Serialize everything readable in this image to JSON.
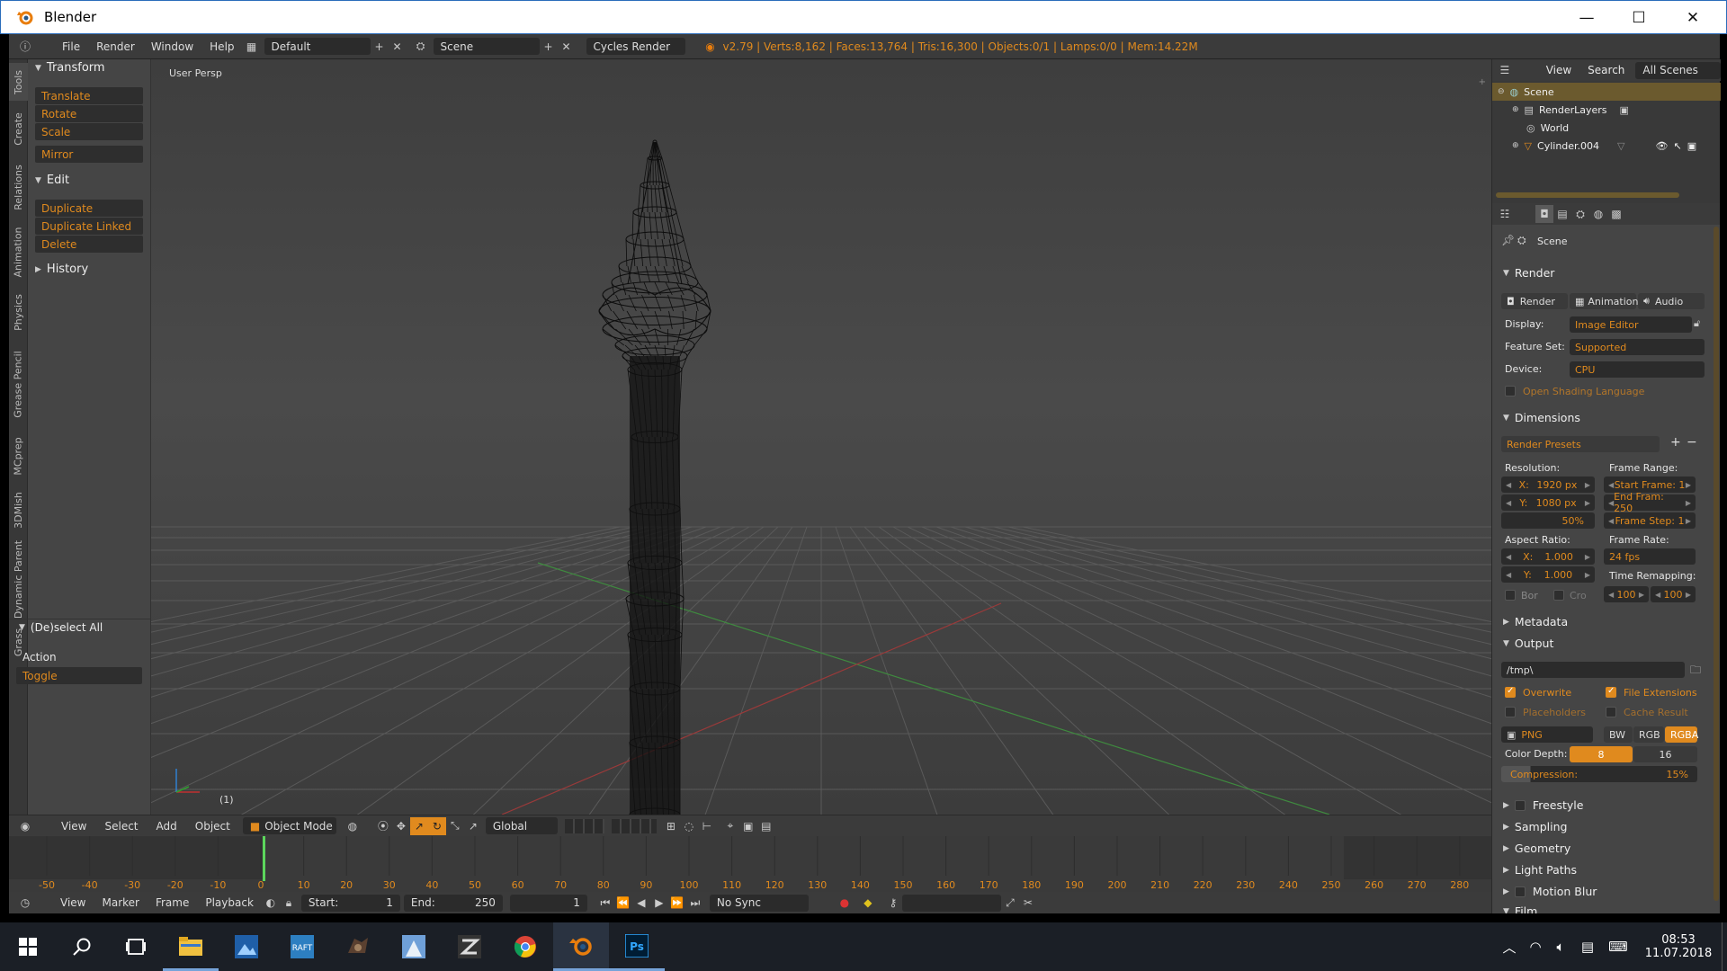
{
  "window": {
    "title": "Blender",
    "minimize": "—",
    "maximize": "☐",
    "close": "✕"
  },
  "menubar": {
    "items": [
      "File",
      "Render",
      "Window",
      "Help"
    ],
    "screen_layout": "Default",
    "scene": "Scene",
    "engine": "Cycles Render",
    "stats": "v2.79 | Verts:8,162 | Faces:13,764 | Tris:16,300 | Objects:0/1 | Lamps:0/0 | Mem:14.22M"
  },
  "tool_tabs": [
    "Tools",
    "Create",
    "Relations",
    "Animation",
    "Physics",
    "Grease Pencil",
    "MCprep",
    "3DMish",
    "Dynamic Parent",
    "Grass"
  ],
  "toolshelf": {
    "transform_header": "Transform",
    "transform_buttons": [
      "Translate",
      "Rotate",
      "Scale"
    ],
    "mirror": "Mirror",
    "edit_header": "Edit",
    "edit_buttons": [
      "Duplicate",
      "Duplicate Linked",
      "Delete"
    ],
    "history_header": "History",
    "operator_header": "(De)select All",
    "action_label": "Action",
    "action_value": "Toggle"
  },
  "viewport": {
    "label": "User Persp",
    "frame": "(1)"
  },
  "view3d_header": {
    "menus": [
      "View",
      "Select",
      "Add",
      "Object"
    ],
    "mode": "Object Mode",
    "orientation": "Global"
  },
  "timeline": {
    "ticks": [
      "-50",
      "-40",
      "-30",
      "-20",
      "-10",
      "0",
      "10",
      "20",
      "30",
      "40",
      "50",
      "60",
      "70",
      "80",
      "90",
      "100",
      "110",
      "120",
      "130",
      "140",
      "150",
      "160",
      "170",
      "180",
      "190",
      "200",
      "210",
      "220",
      "230",
      "240",
      "250",
      "260",
      "270",
      "280"
    ],
    "current_frame": 1
  },
  "timeline_header": {
    "menus": [
      "View",
      "Marker",
      "Frame",
      "Playback"
    ],
    "start_label": "Start:",
    "start_value": "1",
    "end_label": "End:",
    "end_value": "250",
    "current": "1",
    "sync": "No Sync"
  },
  "outliner": {
    "menus": [
      "View",
      "Search"
    ],
    "filter": "All Scenes",
    "rows": [
      {
        "name": "Scene"
      },
      {
        "name": "RenderLayers"
      },
      {
        "name": "World"
      },
      {
        "name": "Cylinder.004"
      }
    ]
  },
  "properties": {
    "context": "Scene",
    "render_header": "Render",
    "render_buttons": [
      "Render",
      "Animation",
      "Audio"
    ],
    "display_label": "Display:",
    "display_value": "Image Editor",
    "feature_label": "Feature Set:",
    "feature_value": "Supported",
    "device_label": "Device:",
    "device_value": "CPU",
    "osl": "Open Shading Language",
    "dimensions_header": "Dimensions",
    "presets": "Render Presets",
    "resolution_label": "Resolution:",
    "res_x_label": "X:",
    "res_x": "1920 px",
    "res_y_label": "Y:",
    "res_y": "1080 px",
    "res_pct": "50%",
    "frame_range_label": "Frame Range:",
    "start_frame": "Start Frame: 1",
    "end_frame": "End Fram: 250",
    "frame_step": "Frame Step: 1",
    "aspect_label": "Aspect Ratio:",
    "aspect_x_label": "X:",
    "aspect_x": "1.000",
    "aspect_y_label": "Y:",
    "aspect_y": "1.000",
    "frame_rate_label": "Frame Rate:",
    "frame_rate": "24 fps",
    "remap_label": "Time Remapping:",
    "remap_old": "100",
    "remap_new": "100",
    "bor": "Bor",
    "cro": "Cro",
    "metadata_header": "Metadata",
    "output_header": "Output",
    "output_path": "/tmp\\",
    "overwrite": "Overwrite",
    "file_ext": "File Extensions",
    "placeholders": "Placeholders",
    "cache_result": "Cache Result",
    "format": "PNG",
    "color_modes": [
      "BW",
      "RGB",
      "RGBA"
    ],
    "color_depth_label": "Color Depth:",
    "depth_8": "8",
    "depth_16": "16",
    "compression": "Compression:",
    "compression_value": "15%",
    "collapsed_sections": [
      "Freestyle",
      "Sampling",
      "Geometry",
      "Light Paths",
      "Motion Blur",
      "Film"
    ]
  },
  "taskbar": {
    "time": "08:53",
    "date": "11.07.2018"
  },
  "colors": {
    "accent": "#e08a1e",
    "panel": "#454545",
    "field": "#2b2b2b"
  }
}
